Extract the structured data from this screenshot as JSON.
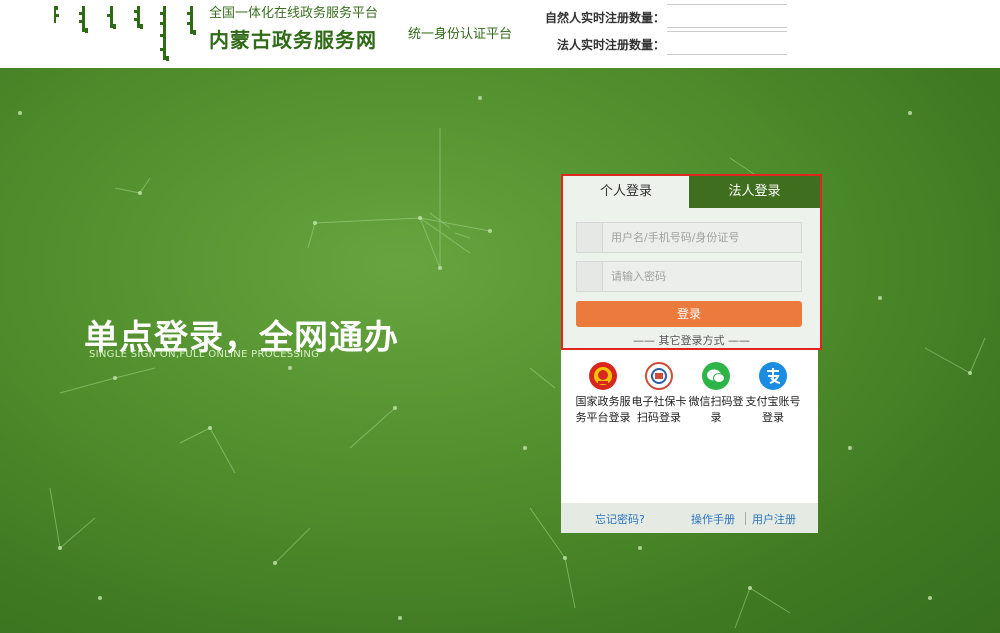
{
  "header": {
    "site_subtitle": "全国一体化在线政务服务平台",
    "site_title": "内蒙古政务服务网",
    "auth_title": "统一身份认证平台",
    "person_reg_label": "自然人实时注册数量：",
    "person_reg_value": "",
    "legal_reg_label": "法人实时注册数量：",
    "legal_reg_value": ""
  },
  "hero": {
    "slogan": "单点登录，全网通办",
    "slogan_en": "SINGLE SIGN ON,FULL ONLINE PROCESSING"
  },
  "login": {
    "tabs": [
      {
        "label": "个人登录",
        "active": true
      },
      {
        "label": "法人登录",
        "active": false
      }
    ],
    "username_placeholder": "用户名/手机号码/身份证号",
    "password_placeholder": "请输入密码",
    "login_button": "登录",
    "other_ways": "—— 其它登录方式 ——"
  },
  "alt_logins": [
    {
      "label": "国家政务服务平台登录",
      "icon": "national-emblem-icon",
      "color": "#d8281d"
    },
    {
      "label": "电子社保卡扫码登录",
      "icon": "social-security-icon",
      "color": "#d04a3a"
    },
    {
      "label": "微信扫码登录",
      "icon": "wechat-icon",
      "color": "#2fb547"
    },
    {
      "label": "支付宝账号登录",
      "icon": "alipay-icon",
      "color": "#1a8de0"
    }
  ],
  "footer": {
    "forgot_password": "忘记密码?",
    "manual": "操作手册",
    "register": "用户注册"
  },
  "colors": {
    "brand_green": "#3f6f1e",
    "login_button": "#ec7a3d",
    "highlight_border": "#e0261e",
    "link_blue": "#2c73c2"
  }
}
